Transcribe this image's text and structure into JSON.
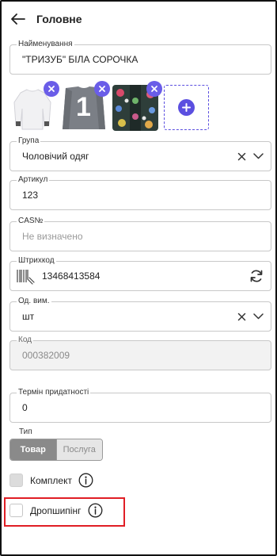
{
  "header": {
    "title": "Головне"
  },
  "name_field": {
    "label": "Найменування",
    "value": "\"ТРИЗУБ\" БІЛА СОРОЧКА"
  },
  "photos": [
    {
      "alt": "white-shirt",
      "text": ""
    },
    {
      "alt": "grey-shirt",
      "text": "1"
    },
    {
      "alt": "embroidered-shirt",
      "text": ""
    }
  ],
  "group_field": {
    "label": "Група",
    "value": "Чоловічий одяг"
  },
  "article_field": {
    "label": "Артикул",
    "value": "123"
  },
  "cas_field": {
    "label": "CAS№",
    "placeholder": "Не визначено"
  },
  "barcode_field": {
    "label": "Штрихкод",
    "value": "13468413584"
  },
  "unit_field": {
    "label": "Од. вим.",
    "value": "шт"
  },
  "code_field": {
    "label": "Код",
    "value": "000382009"
  },
  "shelf_life_field": {
    "label": "Термін придатності",
    "value": "0"
  },
  "type": {
    "label": "Тип",
    "options": [
      "Товар",
      "Послуга"
    ],
    "selected": "Товар"
  },
  "kit": {
    "label": "Комплект",
    "checked": false
  },
  "dropshipping": {
    "label": "Дропшипінг",
    "checked": false
  },
  "colors": {
    "accent": "#5b4fe0",
    "badge": "#6a5de8",
    "highlight": "#e01e25"
  }
}
